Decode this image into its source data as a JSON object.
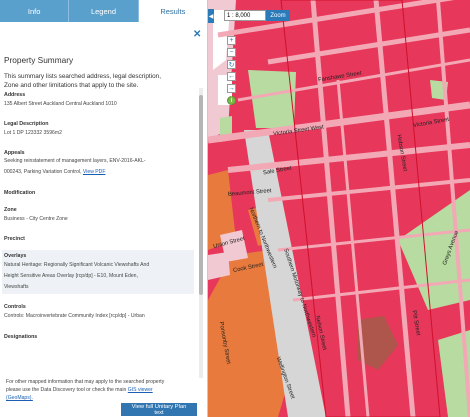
{
  "tabs": [
    "Info",
    "Legend",
    "Results"
  ],
  "panel": {
    "title": "Property Summary",
    "intro_line1": "This summary lists searched address, legal description,",
    "intro_line2": "Zone and other limitations that apply to the site.",
    "address_label": "Address",
    "address_value": "135 Albert Street Auckland Central Auckland 1010",
    "legal_label": "Legal Description",
    "legal_value": "Lot 1 DP 123332 3596m2",
    "appeals_label": "Appeals",
    "appeals_line1": "Seeking reinstatement of management layers, ENV-2016-AKL-",
    "appeals_line2": "000243, Parking Variation Control,",
    "appeals_link": "View PDF",
    "modification_label": "Modification",
    "zone_label": "Zone",
    "zone_value": "Business - City Centre Zone",
    "precinct_label": "Precinct",
    "overlays_label": "Overlays",
    "overlays_line1": "Natural Heritage: Regionally Significant Volcanic Viewshafts And",
    "overlays_line2": "Height Sensitive Areas Overlay [rcp/dp] - E10, Mount Eden,",
    "overlays_line3": "Viewshafts",
    "controls_label": "Controls",
    "controls_value": "Controls: Macroinvertebrate Community Index [rcp/dp] - Urban",
    "designations_label": "Designations",
    "footer_line1": "For other mapped information that may apply to the searched property",
    "footer_line2": "please use the Data Discovery tool or check the main",
    "footer_link1": "GIS viewer",
    "footer_line3": "(GeoMaps).",
    "view_button": "View full Unitary Plan text",
    "close_icon": "close-icon"
  },
  "map": {
    "scale_value": "1 : 8,000",
    "zoom_label": "Zoom",
    "collapse_icon": "chevron-left-icon",
    "controls": [
      "zoom-in-icon",
      "zoom-out-icon",
      "refresh-icon",
      "arrow-left-icon",
      "arrow-right-icon",
      "info-icon"
    ],
    "street_labels": {
      "fanshawe": "Fanshawe Street",
      "victoria": "Victoria Street West",
      "sale": "Sale Street",
      "beaumont": "Beaumont Street",
      "union": "Union Street",
      "cook": "Cook Street",
      "hobson": "Hobson Street",
      "nelson": "Nelson Street",
      "northern_nw": "Northern to Northwestern",
      "southern_nw": "Southern Motorway to Northwestern",
      "pitt": "Pitt Street",
      "ponsonby": "Ponsonby Street",
      "greys": "Greys Avenue",
      "victoria2": "Victoria Street",
      "wellington": "Wellington Street"
    },
    "colors": {
      "city_centre": "#e7375a",
      "roads": "#f3a8b5",
      "mixed_use": "#e97a3d",
      "open_space": "#b7dba0",
      "residential": "#f0c9d2",
      "motorway": "#d6d6d6",
      "highlight_outline": "#d0102c",
      "park_brown": "#a35b4a"
    }
  }
}
